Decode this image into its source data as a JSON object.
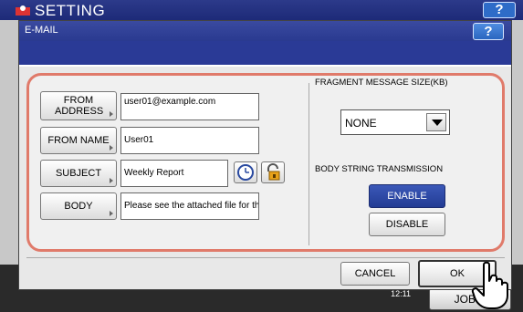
{
  "app": {
    "title": "SETTING",
    "help": "?"
  },
  "dialog": {
    "title": "E-MAIL",
    "help": "?"
  },
  "left": {
    "from_address": {
      "label": "FROM ADDRESS",
      "value": "user01@example.com"
    },
    "from_name": {
      "label": "FROM NAME",
      "value": "User01"
    },
    "subject": {
      "label": "SUBJECT",
      "value": "Weekly Report"
    },
    "body": {
      "label": "BODY",
      "value": "Please see the attached file for th"
    }
  },
  "right": {
    "fragment_label": "FRAGMENT MESSAGE SIZE(KB)",
    "fragment_value": "NONE",
    "body_string_label": "BODY STRING TRANSMISSION",
    "enable": "ENABLE",
    "disable": "DISABLE",
    "enable_selected": true
  },
  "footer": {
    "cancel": "CANCEL",
    "ok": "OK"
  },
  "background": {
    "clock_time": "12:11",
    "jobs_label": "JOB S"
  },
  "icons": {
    "clock": "clock-icon",
    "lock": "padlock-icon",
    "hand": "pointing-hand-icon"
  },
  "colors": {
    "header": "#2a3a90",
    "panel_border": "#e07a6a",
    "selected": "#2c46a4"
  }
}
